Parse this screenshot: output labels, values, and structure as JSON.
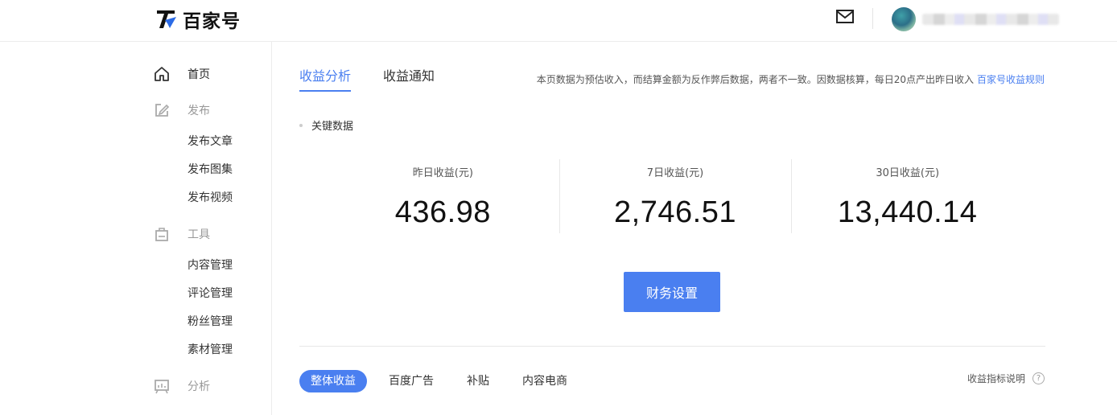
{
  "header": {
    "logo_text": "百家号",
    "icons": {
      "logo": "baijiahao-logo-icon",
      "mail": "mail-icon",
      "avatar": "user-avatar"
    }
  },
  "sidebar": {
    "home": {
      "label": "首页",
      "icon": "home-icon"
    },
    "publish": {
      "label": "发布",
      "icon": "edit-icon",
      "items": [
        "发布文章",
        "发布图集",
        "发布视频"
      ]
    },
    "tools": {
      "label": "工具",
      "icon": "bag-icon",
      "items": [
        "内容管理",
        "评论管理",
        "粉丝管理",
        "素材管理"
      ]
    },
    "analysis": {
      "label": "分析",
      "icon": "chart-board-icon"
    }
  },
  "main": {
    "tabs": [
      {
        "label": "收益分析",
        "active": true
      },
      {
        "label": "收益通知",
        "active": false
      }
    ],
    "notice": {
      "text": "本页数据为预估收入，而结算金额为反作弊后数据，两者不一致。因数据核算，每日20点产出昨日收入",
      "link": "百家号收益规则"
    },
    "section_title": "关键数据",
    "stats": [
      {
        "label": "昨日收益(元)",
        "value": "436.98"
      },
      {
        "label": "7日收益(元)",
        "value": "2,746.51"
      },
      {
        "label": "30日收益(元)",
        "value": "13,440.14"
      }
    ],
    "finance_button": "财务设置",
    "filters": [
      {
        "label": "整体收益",
        "active": true
      },
      {
        "label": "百度广告",
        "active": false
      },
      {
        "label": "补贴",
        "active": false
      },
      {
        "label": "内容电商",
        "active": false
      }
    ],
    "metrics_help": "收益指标说明",
    "help_glyph": "?"
  },
  "colors": {
    "accent": "#4a7ff0",
    "border": "#ececec"
  }
}
